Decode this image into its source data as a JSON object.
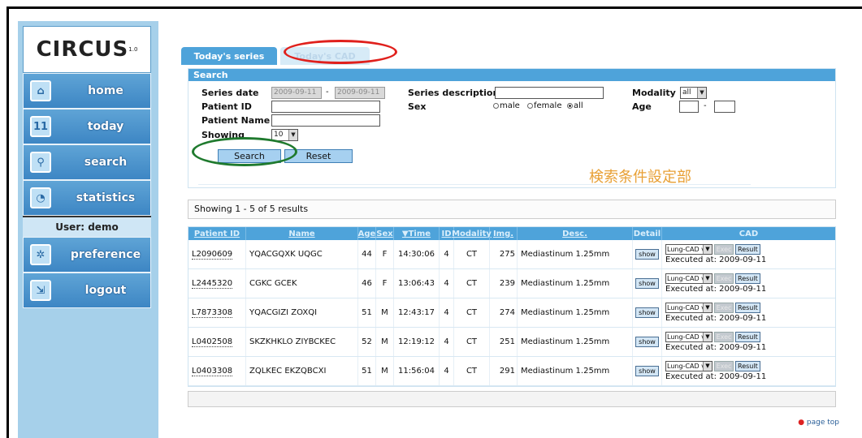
{
  "app": {
    "logo": "CIRCUS",
    "logo_version": "1.0"
  },
  "sidebar": {
    "items": [
      {
        "label": "home",
        "icon": "home-icon"
      },
      {
        "label": "today",
        "icon": "calendar-icon"
      },
      {
        "label": "search",
        "icon": "search-icon"
      },
      {
        "label": "statistics",
        "icon": "chart-icon"
      }
    ],
    "user": "User: demo",
    "items2": [
      {
        "label": "preference",
        "icon": "settings-icon"
      },
      {
        "label": "logout",
        "icon": "logout-icon"
      }
    ]
  },
  "tabs": [
    {
      "label": "Today's series",
      "active": true
    },
    {
      "label": "Today's CAD",
      "active": false
    }
  ],
  "search": {
    "title": "Search",
    "series_date_label": "Series date",
    "date_from": "2009-09-11",
    "date_sep": "-",
    "date_to": "2009-09-11",
    "series_description_label": "Series description",
    "series_description_value": "",
    "modality_label": "Modality",
    "modality_value": "all",
    "patient_id_label": "Patient ID",
    "patient_id_value": "",
    "sex_label": "Sex",
    "sex_options": [
      "male",
      "female",
      "all"
    ],
    "sex_selected": "all",
    "age_label": "Age",
    "age_from": "",
    "age_sep": "-",
    "age_to": "",
    "patient_name_label": "Patient Name",
    "patient_name_value": "",
    "showing_label": "Showing",
    "showing_value": "10",
    "search_button": "Search",
    "reset_button": "Reset",
    "annotation_jp": "検索条件設定部"
  },
  "results": {
    "summary": "Showing 1 - 5 of 5 results",
    "columns": [
      "Patient ID",
      "Name",
      "Age",
      "Sex",
      "▼Time",
      "ID",
      "Modality",
      "Img.",
      "Desc.",
      "Detail",
      "CAD"
    ],
    "rows": [
      {
        "patient_id": "L2090609",
        "name": "YQACGQXK UQGC",
        "age": "44",
        "sex": "F",
        "time": "14:30:06",
        "id": "4",
        "modality": "CT",
        "img": "275",
        "desc": "Mediastinum 1.25mm",
        "detail": "show",
        "cad": "Lung-CAD v.1",
        "cad_btn": "Exec",
        "result": "Result",
        "executed": "Executed at: 2009-09-11"
      },
      {
        "patient_id": "L2445320",
        "name": "CGKC GCEK",
        "age": "46",
        "sex": "F",
        "time": "13:06:43",
        "id": "4",
        "modality": "CT",
        "img": "239",
        "desc": "Mediastinum 1.25mm",
        "detail": "show",
        "cad": "Lung-CAD v.1",
        "cad_btn": "Exec",
        "result": "Result",
        "executed": "Executed at: 2009-09-11"
      },
      {
        "patient_id": "L7873308",
        "name": "YQACGIZI ZOXQI",
        "age": "51",
        "sex": "M",
        "time": "12:43:17",
        "id": "4",
        "modality": "CT",
        "img": "274",
        "desc": "Mediastinum 1.25mm",
        "detail": "show",
        "cad": "Lung-CAD v.1",
        "cad_btn": "Exec",
        "result": "Result",
        "executed": "Executed at: 2009-09-11"
      },
      {
        "patient_id": "L0402508",
        "name": "SKZKHKLO ZIYBCKEC",
        "age": "52",
        "sex": "M",
        "time": "12:19:12",
        "id": "4",
        "modality": "CT",
        "img": "251",
        "desc": "Mediastinum 1.25mm",
        "detail": "show",
        "cad": "Lung-CAD v.1",
        "cad_btn": "Exec",
        "result": "Result",
        "executed": "Executed at: 2009-09-11"
      },
      {
        "patient_id": "L0403308",
        "name": "ZQLKEC EKZQBCXI",
        "age": "51",
        "sex": "M",
        "time": "11:56:04",
        "id": "4",
        "modality": "CT",
        "img": "291",
        "desc": "Mediastinum 1.25mm",
        "detail": "show",
        "cad": "Lung-CAD v.1",
        "cad_btn": "Exec",
        "result": "Result",
        "executed": "Executed at: 2009-09-11"
      }
    ]
  },
  "footer": {
    "page_top": "page top"
  },
  "colors": {
    "accent": "#4ea3da",
    "sidebar_bg": "#a6d0ea",
    "tab_annotation": "#e0201c",
    "showing_annotation": "#1f7a2e",
    "jp_annotation": "#e8a035"
  }
}
